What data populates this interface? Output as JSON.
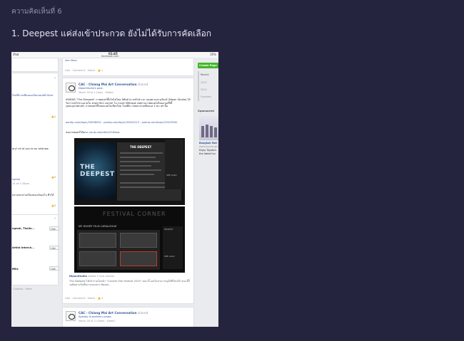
{
  "page": {
    "comment_number": "ความคิดเห็นที่ 6",
    "headline": "1. Deepest แค่ส่งเข้าประกวด ยังไม่ได้รับการคัดเลือก"
  },
  "screenshot": {
    "status_bar": {
      "device": "iPad",
      "time": "01:45",
      "url": "facebook.com",
      "battery": "35%"
    },
    "left_column": {
      "items": [
        "รักษ์ที่ภาพเทียงยอดกิดแสดงย์ค์ More",
        "ary! all of you to an artshow",
        "ngmai",
        "14 at 1:26pm",
        "บลายเขาตามเนื่องขอมเงินเคโจ ทีวได้"
      ],
      "page_suggestions": [
        "ngmai, Thaila...",
        "Artist Interch...",
        "ffilis"
      ],
      "like_label": "Like",
      "footer": "· Cookies · More"
    },
    "feed": {
      "top_card": {
        "see_more": "See More",
        "actions": "Like · Comment · Share ·",
        "like_count": "1"
      },
      "post": {
        "page_name": "CAC - Chiang Mai Art Conversation",
        "shared_word": "shared",
        "shared_from": "NipanStudio's post.",
        "timestamp": "March 26 at 1:10pm · Edited ·",
        "body_text": "#NEWS \"The Deepest\" ภาพยนตร์สั้นไซไฟโดย นิพันธ์ ผ่าวพรักษ์ และ อนุชพ ยอจะนุรัณฑ์ (Nipan Studio) ได้รับการส่งไปร่วมฉายใน short film corner ใน Court Métrage เทศกาลภาพยนตร์เมืองคานส์ปีนี้ (goo.gl/ubtu0l) ภาพยนตร์ทั้งหมดเลยในเชียงใหม่ โดยที่ความพยายามเพียงแค่ 3 คน เท่านั้น",
        "links": "pantip.com/topic/33098432 · pantip.com/topic/33402212 · pantip.com/topic/33419590",
        "trailer_label": "ชมภาพยนตร์ได้ทาง:",
        "trailer_link": "youtu.be/ui6kvGOUKow",
        "photo1": {
          "poster_title": "THE DEEPEST",
          "panel_title": "THE DEEPEST",
          "see_also": "SEE ALSO"
        },
        "photo2": {
          "banner": "FESTIVAL CORNER",
          "catalogue": "MY SHORT FILM CATALOGUE",
          "search": "SEARCH",
          "see_also": "SEE ALSO"
        },
        "shared_line_name": "NipanStudio",
        "shared_line_rest": "added 2 new photos.",
        "shared_text": "The Deepest ได้เข้าร่วมในหน้า \"Cannes film festival 2015\" ขณะนี้ เลยไม่สามารถดูได้ที่ไหนได้ ขณะนี้ก็รอติดตามกันทีมงานของทาง Nipan...",
        "actions": "Like · Comment · Share ·",
        "like_count": "4"
      },
      "post2": {
        "page_name": "CAC - Chiang Mai Art Conversation",
        "shared_word": "shared",
        "shared_from": "Speedy Grandma's photo.",
        "timestamp": "March 26 at 11:35am · Edited ·"
      }
    },
    "right_column": {
      "create_button": "Create Page",
      "years": [
        "Recent",
        "2015",
        "2014",
        "Founded"
      ],
      "sponsored": "Sponsored",
      "ad_title": "Bangkok Mot",
      "ad_domain": "www.toyota-glo",
      "ad_text_1": "Enjoy Toyota's",
      "ad_text_2": "the latest fun"
    }
  }
}
